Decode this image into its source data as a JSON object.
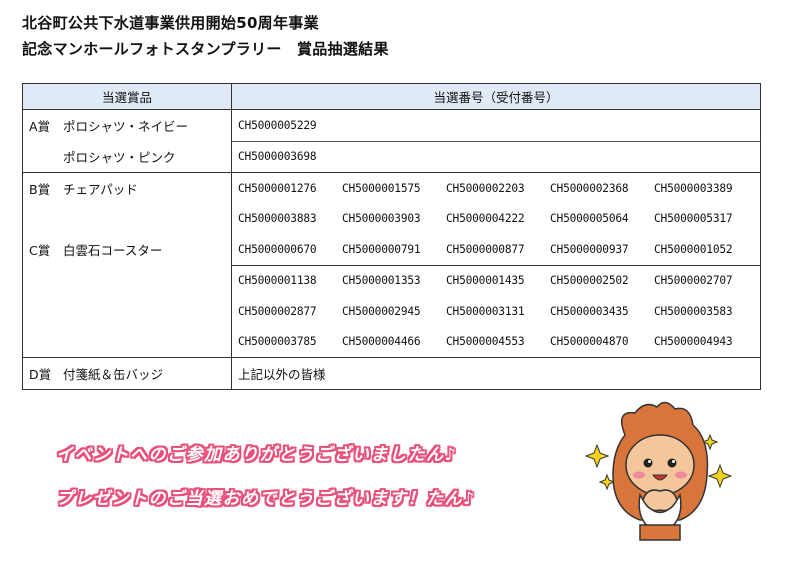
{
  "title": {
    "line1": "北谷町公共下水道事業供用開始50周年事業",
    "line2": "記念マンホールフォトスタンプラリー　賞品抽選結果"
  },
  "table": {
    "headers": {
      "prize": "当選賞品",
      "numbers": "当選番号（受付番号）"
    },
    "a": {
      "grade": "A賞",
      "items": [
        {
          "name": "ポロシャツ・ネイビー",
          "numbers": [
            "CH5000005229"
          ]
        },
        {
          "name": "ポロシャツ・ピンク",
          "numbers": [
            "CH5000003698"
          ]
        }
      ]
    },
    "b": {
      "grade": "B賞",
      "name": "チェアパッド",
      "rows": [
        [
          "CH5000001276",
          "CH5000001575",
          "CH5000002203",
          "CH5000002368",
          "CH5000003389"
        ],
        [
          "CH5000003883",
          "CH5000003903",
          "CH5000004222",
          "CH5000005064",
          "CH5000005317"
        ],
        [
          "CH5000000670",
          "CH5000000791",
          "CH5000000877",
          "CH5000000937",
          "CH5000001052"
        ]
      ]
    },
    "c": {
      "grade": "C賞",
      "name": "白雲石コースター",
      "rows": [
        [
          "CH5000001138",
          "CH5000001353",
          "CH5000001435",
          "CH5000002502",
          "CH5000002707"
        ],
        [
          "CH5000002877",
          "CH5000002945",
          "CH5000003131",
          "CH5000003435",
          "CH5000003583"
        ],
        [
          "CH5000003785",
          "CH5000004466",
          "CH5000004553",
          "CH5000004870",
          "CH5000004943"
        ]
      ]
    },
    "d": {
      "grade": "D賞",
      "name": "付箋紙＆缶バッジ",
      "numbers_text": "上記以外の皆様"
    }
  },
  "messages": {
    "line1": "イベントへのご参加ありがとうございましたん♪",
    "line2": "プレゼントのご当選おめでとうございます！たん♪"
  },
  "colors": {
    "header_bg": "#dfeaf6",
    "message_outline": "#e8507a",
    "mascot_body": "#d9743a"
  }
}
